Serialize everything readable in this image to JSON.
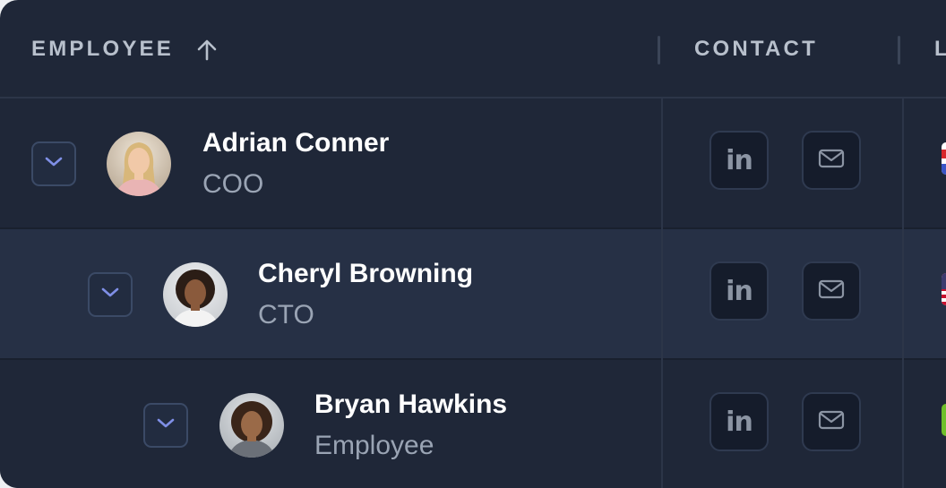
{
  "header": {
    "employee_label": "EMPLOYEE",
    "contact_label": "CONTACT",
    "location_label": "L",
    "sort_icon": "arrow-up-icon"
  },
  "rows": [
    {
      "name": "Adrian Conner",
      "role": "COO",
      "linkedin_label": "in",
      "flag_colors": [
        "#ffffff",
        "#d8262b",
        "#ffffff",
        "#3a55c6"
      ]
    },
    {
      "name": "Cheryl Browning",
      "role": "CTO",
      "linkedin_label": "in",
      "flag_colors": [
        "#c8102e",
        "#ffffff",
        "#3c3b6e"
      ]
    },
    {
      "name": "Bryan Hawkins",
      "role": "Employee",
      "linkedin_label": "in",
      "flag_colors": [
        "#6fbf2a"
      ]
    }
  ],
  "colors": {
    "background": "#1f2738",
    "highlight_row": "#263045",
    "toggle_chevron": "#7f8fe6",
    "header_text": "#b8c0cc"
  }
}
